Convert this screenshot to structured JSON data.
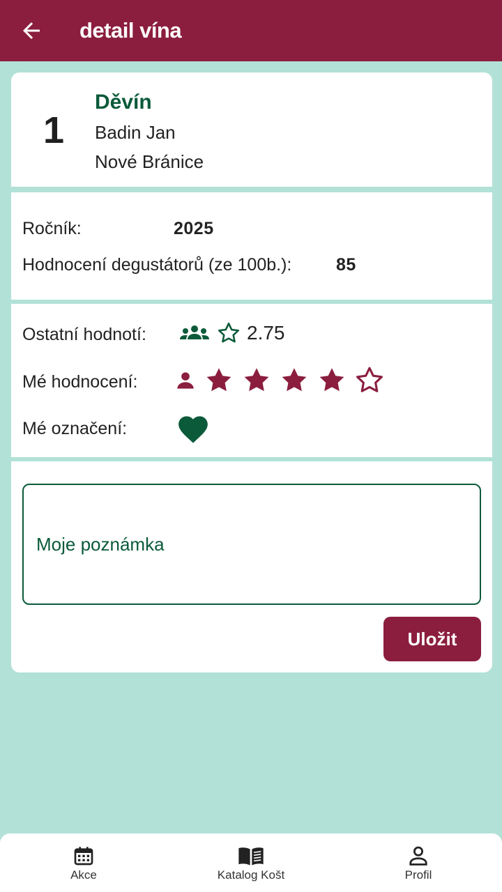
{
  "header": {
    "title": "detail vína",
    "back_icon": "arrow-left-icon"
  },
  "wine": {
    "number": "1",
    "name": "Děvín",
    "producer": "Badin Jan",
    "location": "Nové Bránice"
  },
  "details": {
    "year_label": "Ročník:",
    "year_value": "2025",
    "taster_score_label": "Hodnocení degustátorů (ze 100b.):",
    "taster_score_value": "85"
  },
  "ratings": {
    "others_label": "Ostatní hodnotí:",
    "others_value": "2.75",
    "my_rating_label": "Mé hodnocení:",
    "my_rating_stars": 4,
    "my_rating_max": 5,
    "my_mark_label": "Mé označení:",
    "my_mark_icon": "heart-icon"
  },
  "note": {
    "placeholder": "Moje poznámka",
    "save_label": "Uložit"
  },
  "bottom_nav": {
    "items": [
      {
        "label": "Akce",
        "icon": "calendar-icon"
      },
      {
        "label": "Katalog Košt",
        "icon": "book-icon"
      },
      {
        "label": "Profil",
        "icon": "person-icon"
      }
    ]
  },
  "colors": {
    "primary": "#8b1e3f",
    "accent_green": "#0b5a3a",
    "background": "#b2e1d7"
  }
}
